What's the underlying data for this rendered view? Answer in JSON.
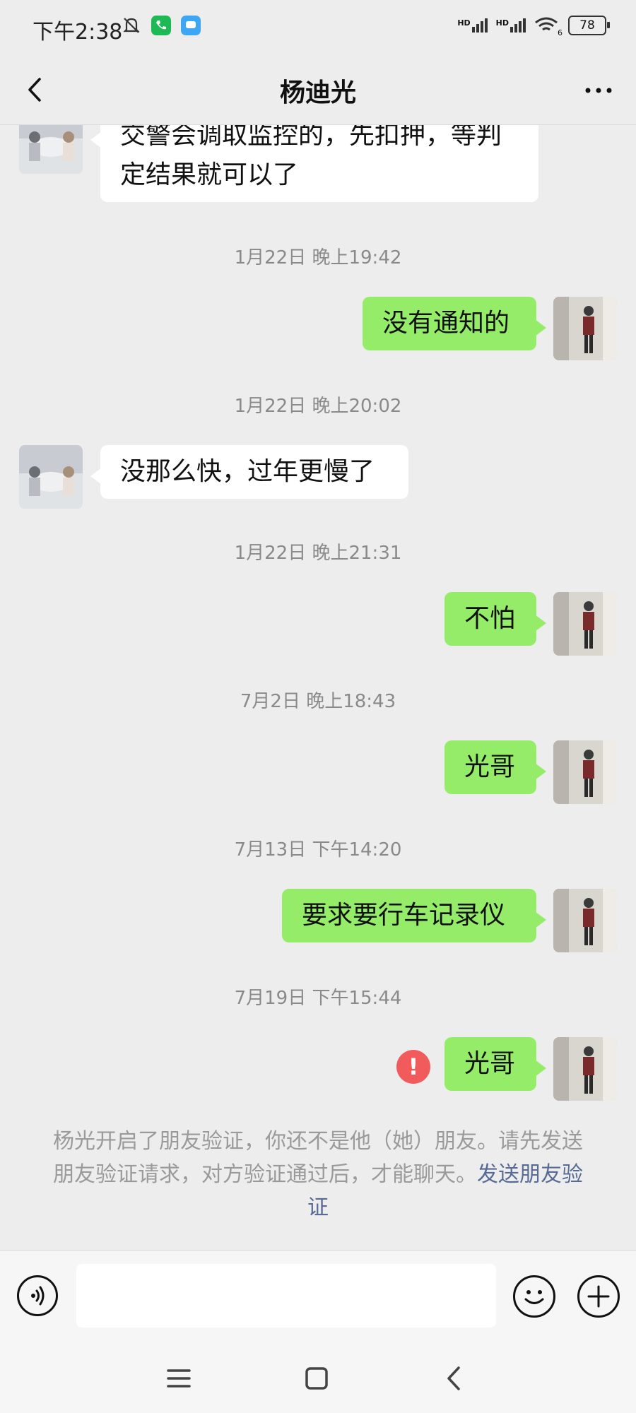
{
  "status": {
    "time": "下午2:38",
    "battery": "78",
    "signal1_label": "HD",
    "signal2_label": "HD",
    "wifi_label": "6"
  },
  "header": {
    "title": "杨迪光",
    "back_icon": "chevron-left-icon",
    "more_icon": "more-horizontal-icon"
  },
  "messages": [
    {
      "type": "in",
      "text": "交警会调取监控的，先扣押，等判定结果就可以了"
    },
    {
      "type": "time",
      "text": "1月22日 晚上19:42"
    },
    {
      "type": "out",
      "text": "没有通知的"
    },
    {
      "type": "time",
      "text": "1月22日 晚上20:02"
    },
    {
      "type": "in",
      "text": "没那么快，过年更慢了"
    },
    {
      "type": "time",
      "text": "1月22日 晚上21:31"
    },
    {
      "type": "out",
      "text": "不怕"
    },
    {
      "type": "time",
      "text": "7月2日 晚上18:43"
    },
    {
      "type": "out",
      "text": "光哥"
    },
    {
      "type": "time",
      "text": "7月13日 下午14:20"
    },
    {
      "type": "out",
      "text": "要求要行车记录仪"
    },
    {
      "type": "time",
      "text": "7月19日 下午15:44"
    },
    {
      "type": "out",
      "text": "光哥",
      "failed": true
    }
  ],
  "system_note": {
    "text": "杨光开启了朋友验证，你还不是他（她）朋友。请先发送朋友验证请求，对方验证通过后，才能聊天。",
    "link": "发送朋友验证"
  },
  "input": {
    "value": "",
    "placeholder": ""
  },
  "colors": {
    "background": "#ededed",
    "bubble_out": "#95ec69",
    "bubble_in": "#ffffff",
    "timestamp": "#8a8a8a",
    "error": "#f25b5b",
    "link": "#576b95"
  }
}
